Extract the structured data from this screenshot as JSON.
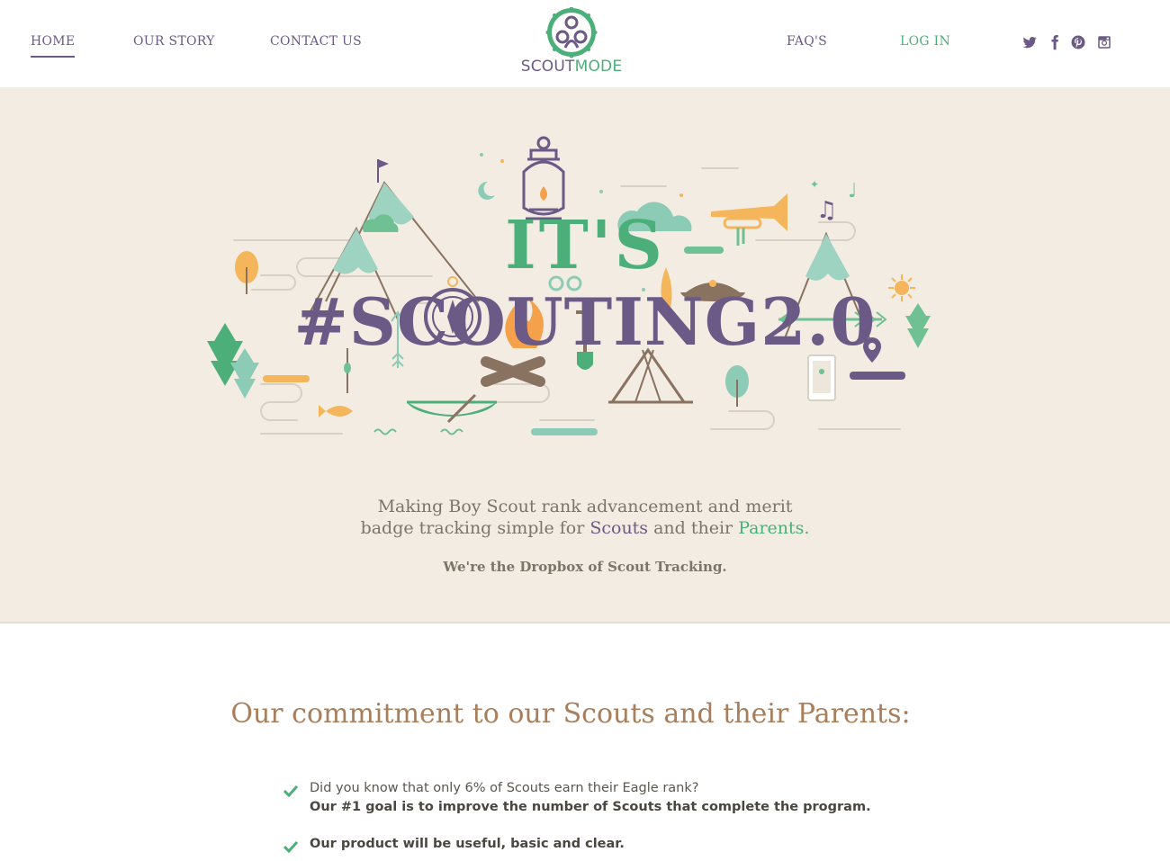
{
  "nav": {
    "home": "HOME",
    "story": "OUR STORY",
    "contact": "CONTACT US",
    "faq": "FAQ'S",
    "login": "LOG IN"
  },
  "logo": {
    "part1": "SCOUT",
    "part2": "MODE"
  },
  "social": [
    "twitter-icon",
    "facebook-icon",
    "pinterest-icon",
    "instagram-icon"
  ],
  "hero": {
    "headline_top": "IT'S",
    "headline_main": "#SCOUTING2.0",
    "tagline_line1": "Making Boy Scout rank advancement and merit",
    "tagline_line2_a": "badge tracking simple for ",
    "tagline_scouts": "Scouts",
    "tagline_line2_b": " and their ",
    "tagline_parents": "Parents.",
    "subline": "We're the Dropbox of Scout Tracking."
  },
  "commitment": {
    "title": "Our commitment to our Scouts and their Parents:",
    "items": [
      {
        "line1": "Did you know that only 6% of Scouts earn their Eagle rank?",
        "line2": "Our #1 goal is to improve the number of Scouts that complete the program."
      },
      {
        "line1": "Our product will be useful, basic and clear."
      }
    ]
  },
  "colors": {
    "purple": "#6b5a85",
    "green": "#4caf7a",
    "cream": "#f3ece2",
    "brown": "#a87f5c",
    "mint": "#8ccbb5",
    "orange": "#f5b55b"
  }
}
